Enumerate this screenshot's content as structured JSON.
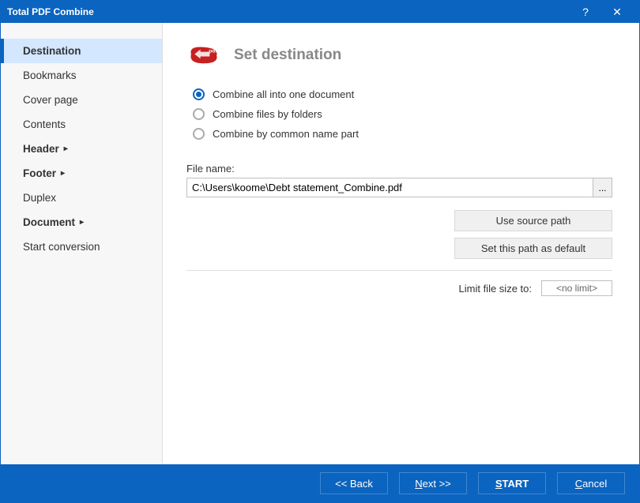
{
  "window": {
    "title": "Total PDF Combine"
  },
  "sidebar": {
    "items": [
      {
        "label": "Destination",
        "selected": true,
        "bold": true,
        "arrow": false
      },
      {
        "label": "Bookmarks",
        "bold": false,
        "arrow": false
      },
      {
        "label": "Cover page",
        "bold": false,
        "arrow": false
      },
      {
        "label": "Contents",
        "bold": false,
        "arrow": false
      },
      {
        "label": "Header",
        "bold": true,
        "arrow": true
      },
      {
        "label": "Footer",
        "bold": true,
        "arrow": true
      },
      {
        "label": "Duplex",
        "bold": false,
        "arrow": false
      },
      {
        "label": "Document",
        "bold": true,
        "arrow": true
      },
      {
        "label": "Start conversion",
        "bold": false,
        "arrow": false
      }
    ]
  },
  "main": {
    "title": "Set destination",
    "radios": [
      {
        "label": "Combine all into one document",
        "checked": true
      },
      {
        "label": "Combine files by folders",
        "checked": false
      },
      {
        "label": "Combine by common name part",
        "checked": false
      }
    ],
    "filename_label": "File name:",
    "filename_value": "C:\\Users\\koome\\Debt statement_Combine.pdf",
    "browse_label": "...",
    "use_source_btn": "Use source path",
    "set_default_btn": "Set this path as default",
    "limit_label": "Limit file size to:",
    "limit_value": "<no limit>"
  },
  "footer": {
    "back": "<< Back",
    "next_prefix": "N",
    "next_suffix": "ext >>",
    "start_prefix": "S",
    "start_suffix": "TART",
    "cancel_prefix": "C",
    "cancel_suffix": "ancel"
  }
}
